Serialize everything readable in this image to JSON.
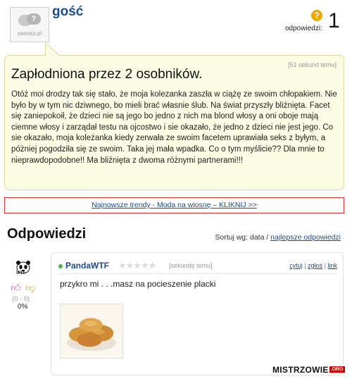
{
  "header": {
    "avatar_text": "sanoso.pl",
    "username": "gość",
    "answers_label": "odpowiedzi:",
    "answers_count": "1"
  },
  "question": {
    "timestamp": "[51 sekund temu]",
    "title": "Zapłodniona przez 2 osobników.",
    "body": "Otóż moi drodzy tak się stało, że moja kolezanka zaszła w ciążę ze swoim chłopakiem. Nie było by w tym nic dziwnego, bo mieli brać własnie ślub. Na świat przyszły bliźnięta. Facet się zaniepokoił, że dzieci nie są jego bo jedno z nich ma blond włosy a oni oboje mają ciemne włosy i zarządał testu na ojcostwo i sie okazało, że jedno z dzieci nie jest jego. Co sie okazało, moja koleżanka kiedy zerwała ze swoim facetem uprawiała seks z byłym, a póżniej pogodziła się ze swoim. Taka jej mała wpadka. Co o tym myślicie?? Dla mnie to nieprawdopodobne!! Ma bliźnięta z dwoma różnymi partnerami!!!"
  },
  "promo": {
    "link_text": "Najnowsze trendy - Moda na wiosnę – KLIKNIJ >>"
  },
  "answers_section": {
    "heading": "Odpowiedzi",
    "sort_label": "Sortuj wg: data /",
    "sort_link": "najlepsze odpowiedzi"
  },
  "answer": {
    "user": "PandaWTF",
    "logo_text": "WTF",
    "stars": "★★★★★",
    "rating": 0,
    "time": "[sekundę temu]",
    "actions": {
      "cytuj": "cytuj",
      "zglos": "zgłoś",
      "link": "link"
    },
    "vote_counts": "(0 - 0)",
    "vote_percent": "0%",
    "text": "przykro mi . . .masz na pocieszenie placki"
  },
  "branding": {
    "main": "MISTRZOWIE",
    "suffix": ".ORG"
  },
  "icons": {
    "question_badge": "question-circle-icon",
    "thumbs_up": "thumbs-up-icon",
    "thumbs_down": "thumbs-down-icon",
    "online": "online-dot-icon",
    "panda": "wwf-panda-logo"
  },
  "colors": {
    "link": "#1a4a9a",
    "bubble_bg": "#fcfbe4",
    "promo_border": "#dd3333",
    "badge": "#f0a800"
  }
}
